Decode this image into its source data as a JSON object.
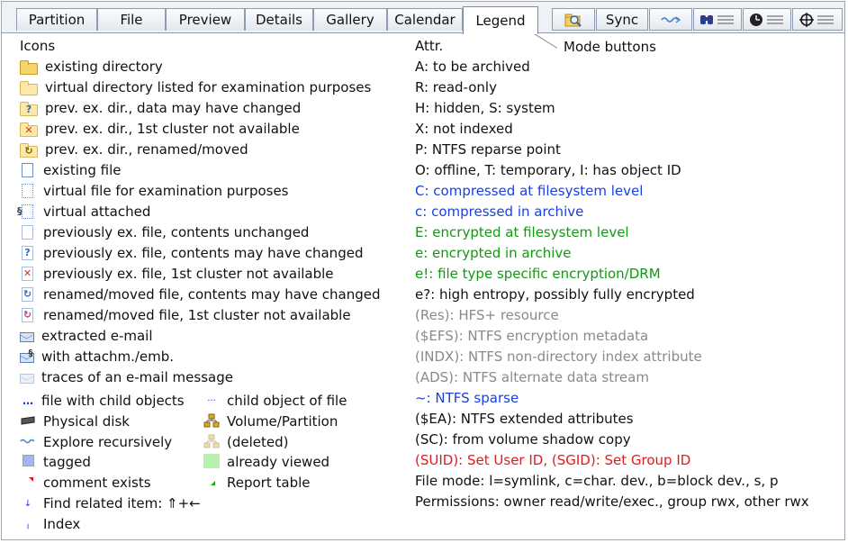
{
  "tabs": [
    {
      "label": "Partition"
    },
    {
      "label": "File"
    },
    {
      "label": "Preview"
    },
    {
      "label": "Details"
    },
    {
      "label": "Gallery"
    },
    {
      "label": "Calendar"
    },
    {
      "label": "Legend",
      "active": true
    }
  ],
  "mode_buttons": {
    "sync_label": "Sync",
    "annotation": "Mode buttons"
  },
  "icons": {
    "heading": "Icons",
    "items": [
      {
        "icon": "folder-icon",
        "label": "existing directory"
      },
      {
        "icon": "virtual-folder-icon",
        "label": "virtual directory listed for examination purposes"
      },
      {
        "icon": "folder-question-icon",
        "label": "prev. ex. dir., data may have changed"
      },
      {
        "icon": "folder-x-icon",
        "label": "prev. ex. dir., 1st cluster not available"
      },
      {
        "icon": "folder-renamed-icon",
        "label": "prev. ex. dir., renamed/moved"
      },
      {
        "icon": "file-icon",
        "label": "existing file"
      },
      {
        "icon": "virtual-file-icon",
        "label": "virtual file for examination purposes"
      },
      {
        "icon": "attached-file-icon",
        "label": "virtual attached"
      },
      {
        "icon": "prev-file-icon",
        "label": "previously ex. file, contents unchanged"
      },
      {
        "icon": "file-question-icon",
        "label": "previously ex. file, contents may have changed"
      },
      {
        "icon": "file-x-icon",
        "label": "previously ex. file, 1st cluster not available"
      },
      {
        "icon": "file-renamed-icon",
        "label": "renamed/moved file, contents may have changed"
      },
      {
        "icon": "file-renamed-red-icon",
        "label": "renamed/moved file, 1st cluster not available"
      },
      {
        "icon": "email-icon",
        "label": "extracted e-mail"
      },
      {
        "icon": "email-attachment-icon",
        "label": "with attachm./emb."
      },
      {
        "icon": "email-trace-icon",
        "label": "traces of an e-mail message"
      }
    ],
    "bottom_left": [
      {
        "icon": "child-objects-icon",
        "label": "file with child objects"
      },
      {
        "icon": "physical-disk-icon",
        "label": "Physical disk"
      },
      {
        "icon": "explore-recursively-icon",
        "label": "Explore recursively"
      },
      {
        "icon": "tagged-icon",
        "label": "tagged"
      },
      {
        "icon": "comment-icon",
        "label": "comment exists"
      },
      {
        "icon": "related-item-icon",
        "label": "Find related item: ⇑+←"
      },
      {
        "icon": "index-icon",
        "label": "Index"
      }
    ],
    "bottom_right": [
      {
        "icon": "child-object-icon",
        "label": "child object of file"
      },
      {
        "icon": "volume-partition-icon",
        "label": "Volume/Partition"
      },
      {
        "icon": "deleted-volume-icon",
        "label": "(deleted)"
      },
      {
        "icon": "viewed-icon",
        "label": "already viewed"
      },
      {
        "icon": "report-table-icon",
        "label": "Report table"
      }
    ]
  },
  "attributes": {
    "heading": "Attr.",
    "colors": {
      "blue": "#1a3fe0",
      "green": "#139813",
      "gray": "#8a8a8a",
      "red": "#e01b1b"
    },
    "items": [
      {
        "text": "A: to be archived",
        "color": "black"
      },
      {
        "text": "R: read-only",
        "color": "black"
      },
      {
        "text": "H: hidden, S: system",
        "color": "black"
      },
      {
        "text": "X: not indexed",
        "color": "black"
      },
      {
        "text": "P: NTFS reparse point",
        "color": "black"
      },
      {
        "text": "O: offline, T: temporary, I: has object ID",
        "color": "black"
      },
      {
        "text": "C: compressed at filesystem level",
        "color": "blue"
      },
      {
        "text": "c: compressed in archive",
        "color": "blue"
      },
      {
        "text": "E: encrypted at filesystem level",
        "color": "green"
      },
      {
        "text": "e: encrypted in archive",
        "color": "green"
      },
      {
        "text": "e!: file type specific encryption/DRM",
        "color": "green"
      },
      {
        "text": "e?: high entropy, possibly fully encrypted",
        "color": "black"
      },
      {
        "text": "(Res): HFS+ resource",
        "color": "gray"
      },
      {
        "text": "($EFS): NTFS encryption metadata",
        "color": "gray"
      },
      {
        "text": "(INDX): NTFS non-directory index attribute",
        "color": "gray"
      },
      {
        "text": "(ADS): NTFS alternate data stream",
        "color": "gray"
      },
      {
        "text": "~: NTFS sparse",
        "color": "blue"
      },
      {
        "text": "($EA): NTFS extended attributes",
        "color": "black"
      },
      {
        "text": "(SC): from volume shadow copy",
        "color": "black"
      },
      {
        "text": "(SUID): Set User ID, (SGID): Set Group ID",
        "color": "red"
      },
      {
        "text": "File mode: l=symlink, c=char. dev., b=block dev., s, p",
        "color": "black"
      },
      {
        "text": "Permissions: owner read/write/exec., group rwx, other rwx",
        "color": "black"
      }
    ]
  }
}
